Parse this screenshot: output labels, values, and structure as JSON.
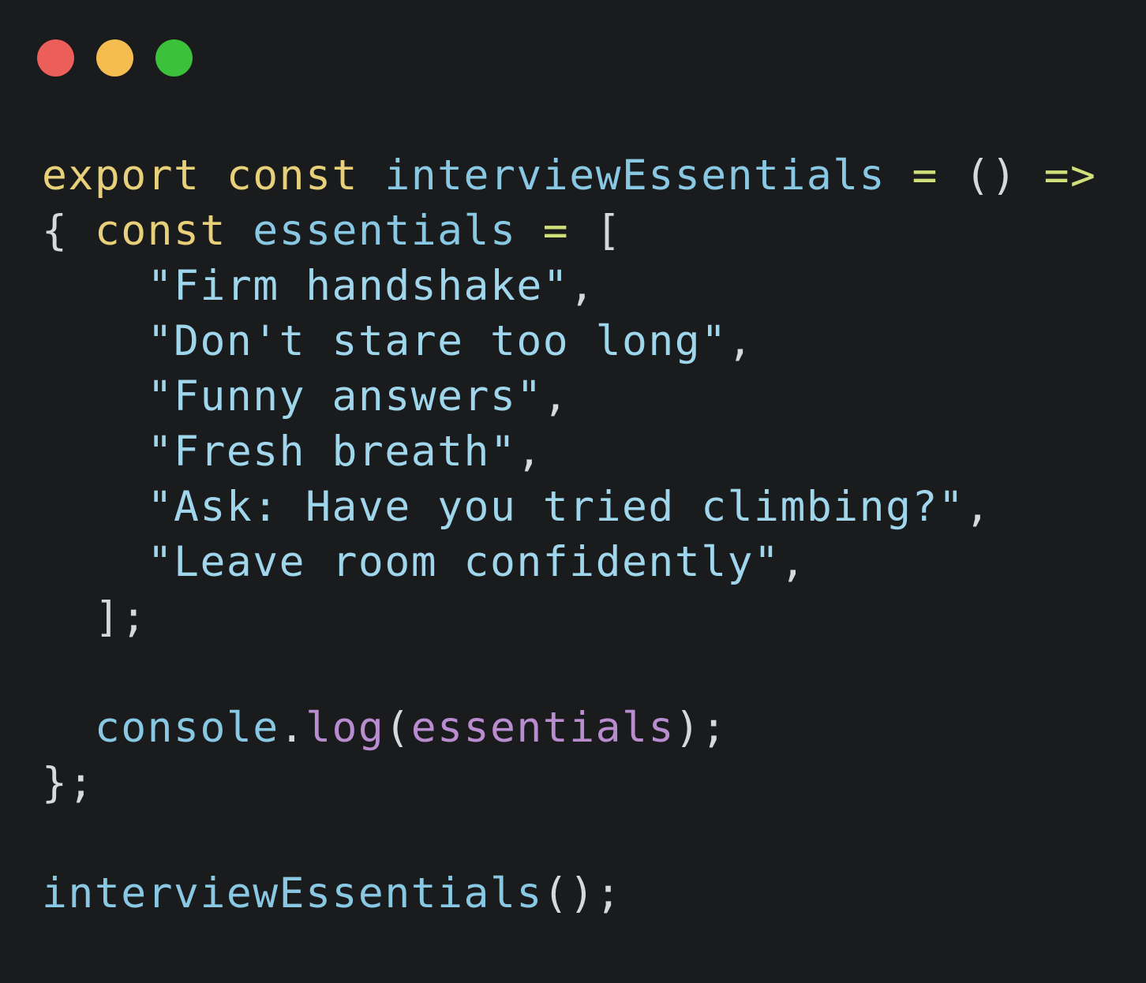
{
  "window_controls": [
    {
      "name": "close-button",
      "color": "#ec5f59"
    },
    {
      "name": "minimize-button",
      "color": "#f5bd4f"
    },
    {
      "name": "zoom-button",
      "color": "#3cc13b"
    }
  ],
  "colors": {
    "background": "#191b1d",
    "keyword": "#e8d07a",
    "identifier": "#89c8e3",
    "operator": "#cfe07a",
    "string": "#9fd6ec",
    "punctuation": "#d6d8db",
    "method": "#b98cd0",
    "argument": "#b98cd0"
  },
  "code": {
    "lines": [
      [
        {
          "t": "export const ",
          "c": "keyword"
        },
        {
          "t": "interviewEssentials",
          "c": "identifier"
        },
        {
          "t": " = ",
          "c": "operator"
        },
        {
          "t": "() ",
          "c": "punctuation"
        },
        {
          "t": "=>",
          "c": "operator"
        }
      ],
      [
        {
          "t": "{ ",
          "c": "punctuation"
        },
        {
          "t": "const ",
          "c": "keyword"
        },
        {
          "t": "essentials",
          "c": "identifier"
        },
        {
          "t": " = ",
          "c": "operator"
        },
        {
          "t": "[",
          "c": "punctuation"
        }
      ],
      [
        {
          "t": "    \"Firm handshake\"",
          "c": "string"
        },
        {
          "t": ",",
          "c": "punctuation"
        }
      ],
      [
        {
          "t": "    \"Don't stare too long\"",
          "c": "string"
        },
        {
          "t": ",",
          "c": "punctuation"
        }
      ],
      [
        {
          "t": "    \"Funny answers\"",
          "c": "string"
        },
        {
          "t": ",",
          "c": "punctuation"
        }
      ],
      [
        {
          "t": "    \"Fresh breath\"",
          "c": "string"
        },
        {
          "t": ",",
          "c": "punctuation"
        }
      ],
      [
        {
          "t": "    \"Ask: Have you tried climbing?\"",
          "c": "string"
        },
        {
          "t": ",",
          "c": "punctuation"
        }
      ],
      [
        {
          "t": "    \"Leave room confidently\"",
          "c": "string"
        },
        {
          "t": ",",
          "c": "punctuation"
        }
      ],
      [
        {
          "t": "  ];",
          "c": "punctuation"
        }
      ],
      [],
      [
        {
          "t": "  console",
          "c": "identifier"
        },
        {
          "t": ".",
          "c": "punctuation"
        },
        {
          "t": "log",
          "c": "method"
        },
        {
          "t": "(",
          "c": "punctuation"
        },
        {
          "t": "essentials",
          "c": "argument"
        },
        {
          "t": ");",
          "c": "punctuation"
        }
      ],
      [
        {
          "t": "};",
          "c": "punctuation"
        }
      ],
      [],
      [
        {
          "t": "interviewEssentials",
          "c": "identifier"
        },
        {
          "t": "();",
          "c": "punctuation"
        }
      ]
    ]
  }
}
